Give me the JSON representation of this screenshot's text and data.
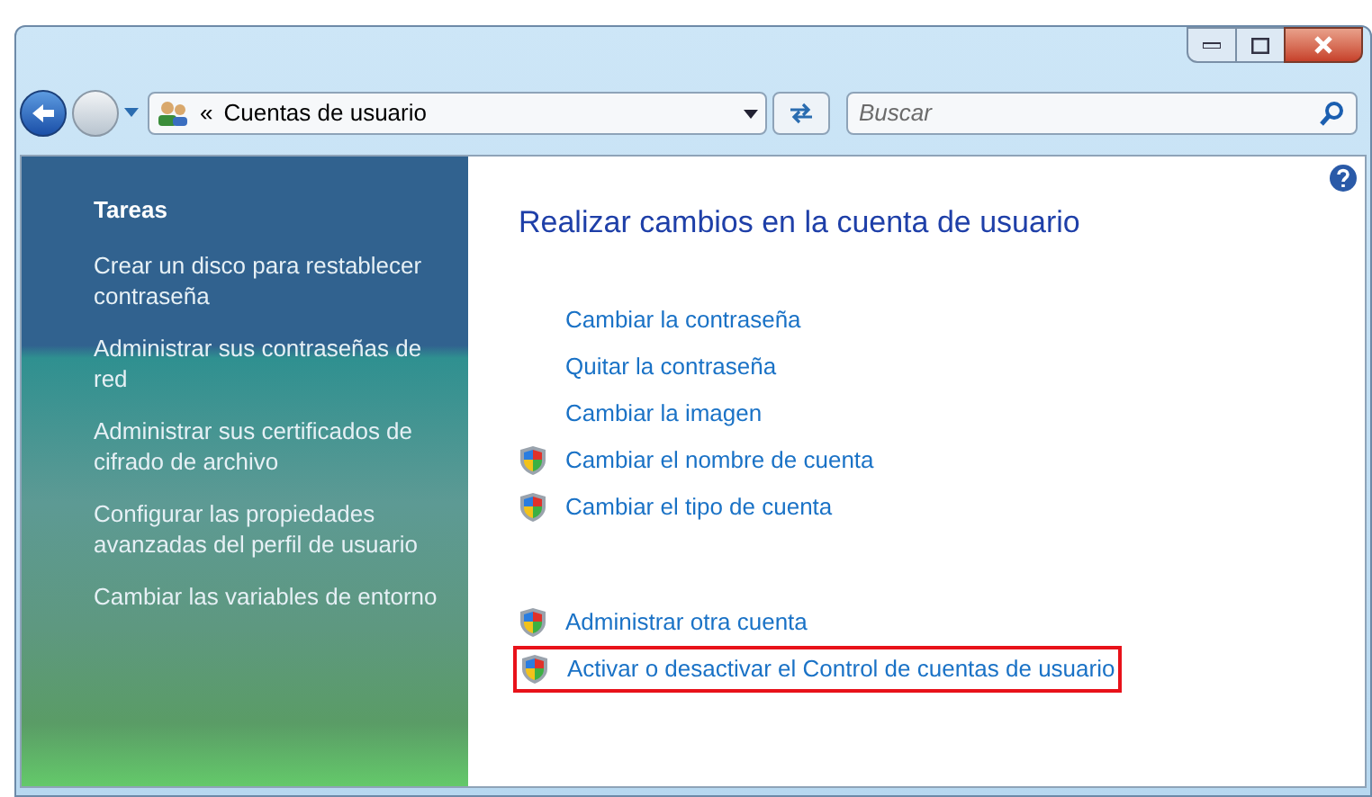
{
  "address": {
    "separator": "«",
    "path": "Cuentas de usuario"
  },
  "search": {
    "placeholder": "Buscar"
  },
  "sidebar": {
    "title": "Tareas",
    "items": [
      {
        "label": "Crear un disco para restablecer contraseña"
      },
      {
        "label": "Administrar sus contraseñas de red"
      },
      {
        "label": "Administrar sus certificados de cifrado de archivo"
      },
      {
        "label": "Configurar las propiedades avanzadas del perfil de usuario"
      },
      {
        "label": "Cambiar las variables de entorno"
      }
    ]
  },
  "main": {
    "title": "Realizar cambios en la cuenta de usuario",
    "groups": [
      {
        "links": [
          {
            "label": "Cambiar la contraseña",
            "shield": false,
            "highlighted": false
          },
          {
            "label": "Quitar la contraseña",
            "shield": false,
            "highlighted": false
          },
          {
            "label": "Cambiar la imagen",
            "shield": false,
            "highlighted": false
          },
          {
            "label": "Cambiar el nombre de cuenta",
            "shield": true,
            "highlighted": false
          },
          {
            "label": "Cambiar el tipo de cuenta",
            "shield": true,
            "highlighted": false
          }
        ]
      },
      {
        "links": [
          {
            "label": "Administrar otra cuenta",
            "shield": true,
            "highlighted": false
          },
          {
            "label": "Activar o desactivar el Control de cuentas de usuario",
            "shield": true,
            "highlighted": true
          }
        ]
      }
    ]
  }
}
